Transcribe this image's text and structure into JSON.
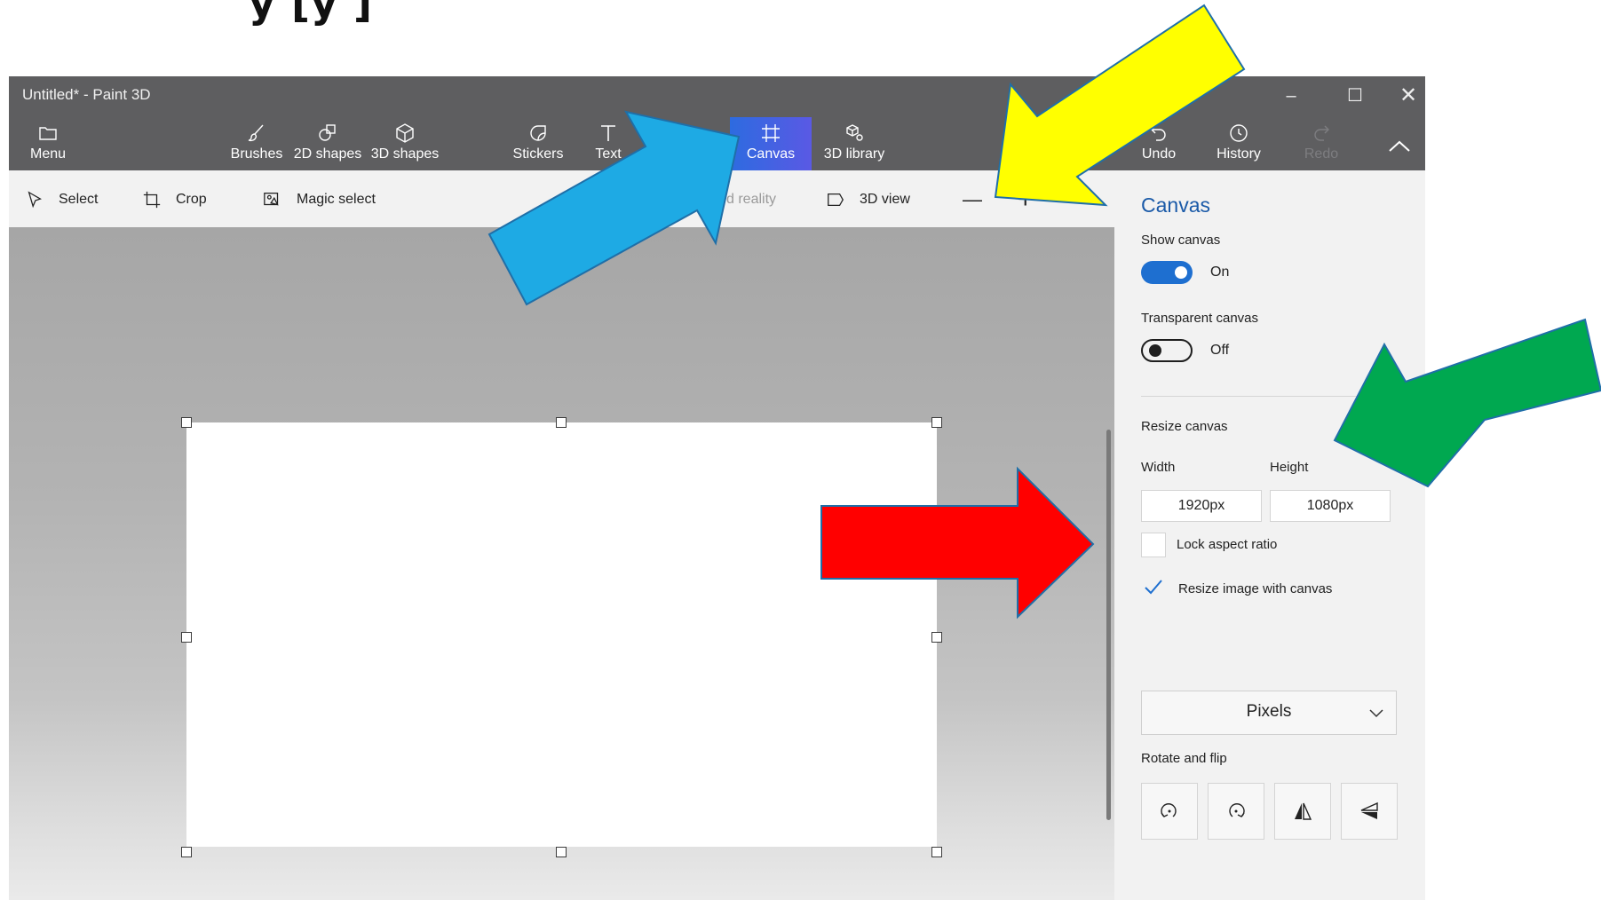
{
  "caption_fragment": "y                        [y        ]",
  "window": {
    "title": "Untitled* - Paint 3D",
    "minimize": "–",
    "maximize": "☐",
    "close": "✕"
  },
  "toolbar": {
    "menu": "Menu",
    "brushes": "Brushes",
    "shapes2d": "2D shapes",
    "shapes3d": "3D shapes",
    "stickers": "Stickers",
    "text": "Text",
    "canvas": "Canvas",
    "library3d": "3D library",
    "undo": "Undo",
    "history": "History",
    "redo": "Redo"
  },
  "subbar": {
    "select": "Select",
    "crop": "Crop",
    "magic_select": "Magic select",
    "mixed_reality_fragment": "d reality",
    "view3d": "3D view",
    "zoom_out": "—",
    "zoom_in": "+"
  },
  "panel": {
    "title": "Canvas",
    "show_canvas_label": "Show canvas",
    "show_canvas_state": "On",
    "transparent_label": "Transparent canvas",
    "transparent_state": "Off",
    "resize_label": "Resize canvas",
    "width_label": "Width",
    "height_label": "Height",
    "width_value": "1920px",
    "height_value": "1080px",
    "lock_aspect": "Lock aspect ratio",
    "resize_image": "Resize image with canvas",
    "units": "Pixels",
    "rotate_label": "Rotate and flip"
  },
  "state": {
    "show_canvas": true,
    "transparent_canvas": false,
    "lock_aspect_ratio": false,
    "resize_image_with_canvas": true
  },
  "colors": {
    "titlebar": "#5e5e60",
    "accent_blue": "#1e6fd0",
    "canvas_active": "#3b63e2",
    "arrow_yellow": "#ffff00",
    "arrow_blue": "#1eaae4",
    "arrow_red": "#ff0000",
    "arrow_green": "#00a850"
  }
}
